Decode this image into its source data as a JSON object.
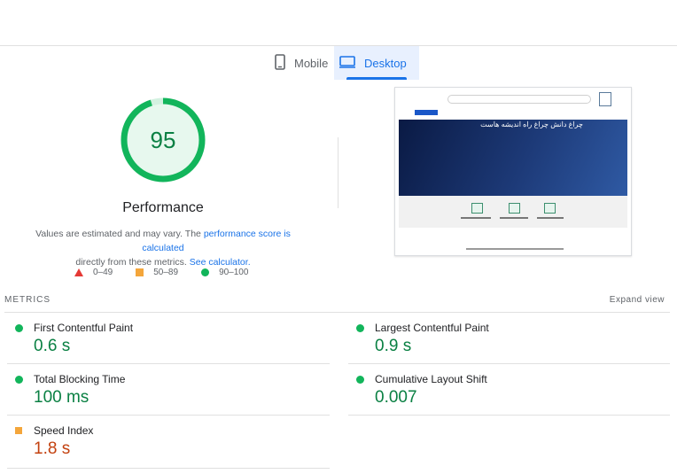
{
  "tabs": {
    "mobile_label": "Mobile",
    "desktop_label": "Desktop",
    "selected": "Desktop"
  },
  "performance": {
    "score": "95",
    "score_fraction": 0.95,
    "title": "Performance",
    "note_prefix": "Values are estimated and may vary. The ",
    "note_link1": "performance score is calculated",
    "note_mid": " directly from these metrics. ",
    "note_link2": "See calculator.",
    "colors": {
      "pass": "#12b55b",
      "pass_text": "#0a8043",
      "average": "#f4a63b",
      "fail": "#e53935",
      "average_text": "#c3410f"
    }
  },
  "legend": [
    {
      "shape": "triangle",
      "label": "0–49"
    },
    {
      "shape": "square",
      "label": "50–89"
    },
    {
      "shape": "circle",
      "label": "90–100"
    }
  ],
  "thumbnail": {
    "hero_title": "چراغ دانش چراغ راه اندیشه هاست"
  },
  "metrics": {
    "heading": "METRICS",
    "expand_label": "Expand view",
    "items": [
      {
        "name": "First Contentful Paint",
        "value": "0.6 s",
        "rating": "pass"
      },
      {
        "name": "Largest Contentful Paint",
        "value": "0.9 s",
        "rating": "pass"
      },
      {
        "name": "Total Blocking Time",
        "value": "100 ms",
        "rating": "pass"
      },
      {
        "name": "Cumulative Layout Shift",
        "value": "0.007",
        "rating": "pass"
      },
      {
        "name": "Speed Index",
        "value": "1.8 s",
        "rating": "average"
      }
    ]
  }
}
